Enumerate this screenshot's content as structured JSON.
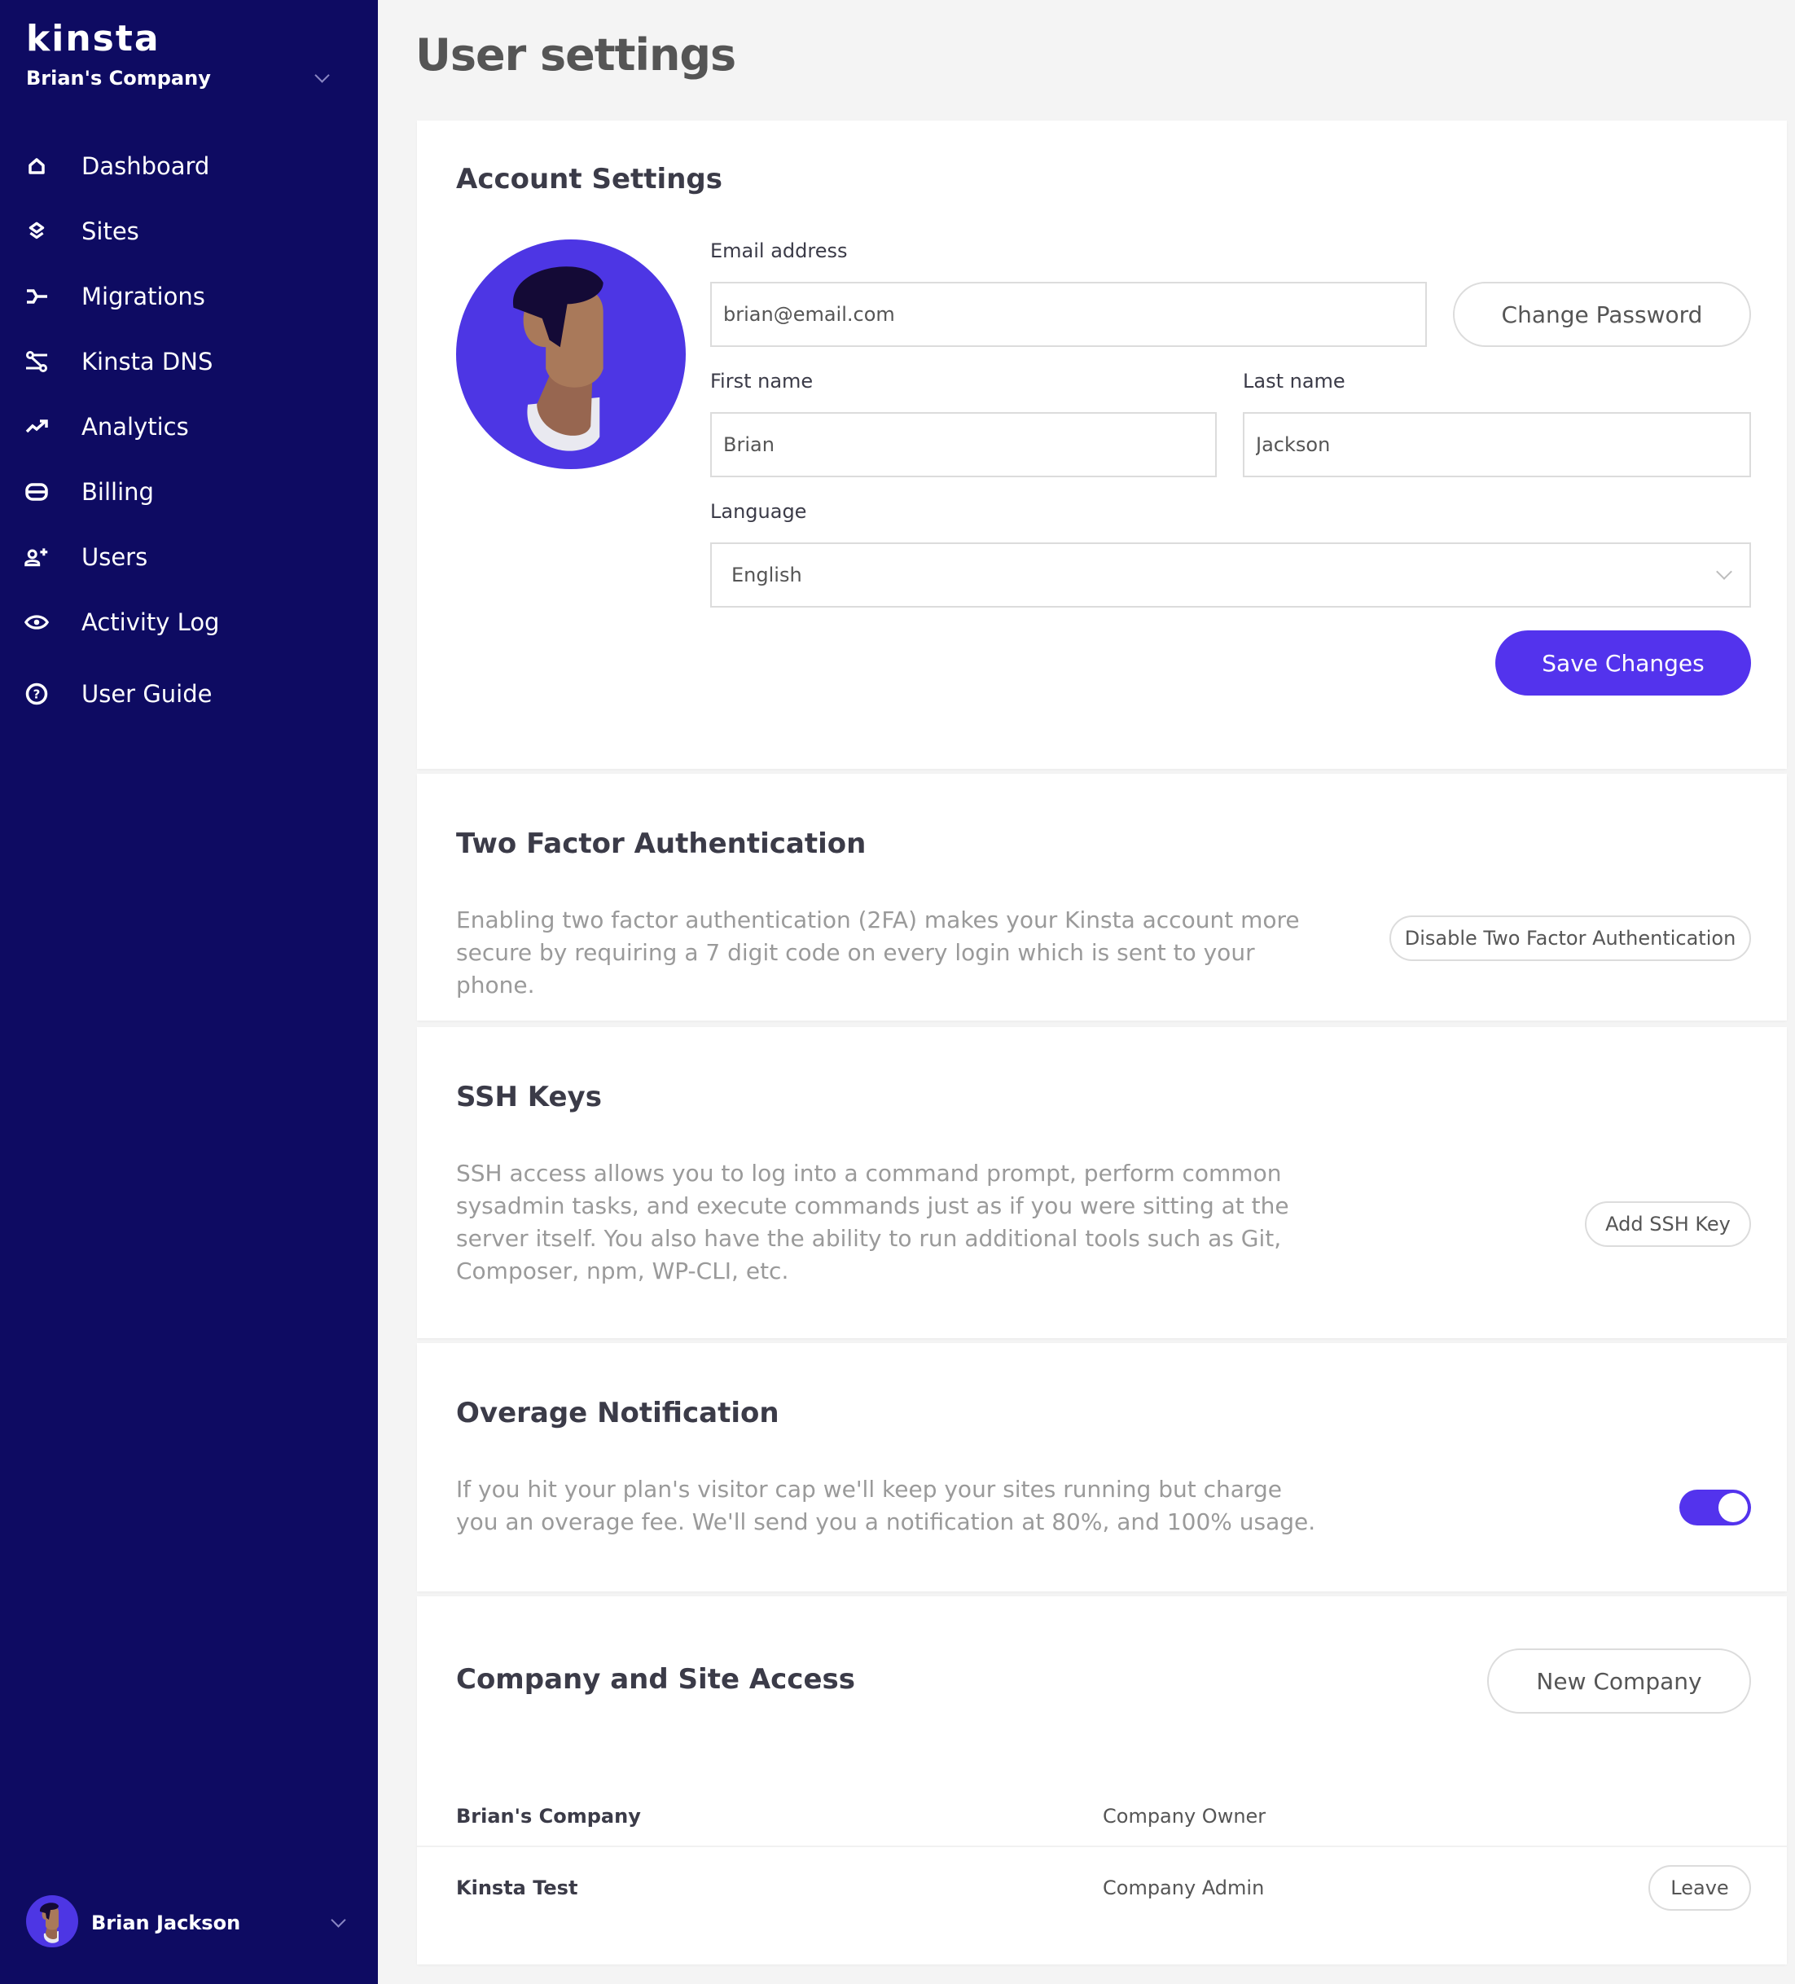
{
  "app": {
    "brand": "kinsta",
    "page_title": "User settings"
  },
  "sidebar": {
    "company_name": "Brian's Company",
    "items": [
      {
        "label": "Dashboard",
        "icon": "home-icon"
      },
      {
        "label": "Sites",
        "icon": "layers-icon"
      },
      {
        "label": "Migrations",
        "icon": "migrations-icon"
      },
      {
        "label": "Kinsta DNS",
        "icon": "dns-icon"
      },
      {
        "label": "Analytics",
        "icon": "trend-up-icon"
      },
      {
        "label": "Billing",
        "icon": "billing-icon"
      },
      {
        "label": "Users",
        "icon": "add-user-icon"
      },
      {
        "label": "Activity Log",
        "icon": "eye-icon"
      },
      {
        "label": "User Guide",
        "icon": "help-circle-icon"
      }
    ],
    "user_name": "Brian Jackson"
  },
  "account": {
    "title": "Account Settings",
    "email_label": "Email address",
    "email_value": "brian@email.com",
    "change_password": "Change Password",
    "first_name_label": "First name",
    "first_name_value": "Brian",
    "last_name_label": "Last name",
    "last_name_value": "Jackson",
    "language_label": "Language",
    "language_value": "English",
    "save": "Save Changes"
  },
  "two_factor": {
    "title": "Two Factor Authentication",
    "description": "Enabling two factor authentication (2FA) makes your Kinsta account more secure by requiring a 7 digit code on every login which is sent to your phone.",
    "button": "Disable Two Factor Authentication"
  },
  "ssh": {
    "title": "SSH Keys",
    "description": "SSH access allows you to log into a command prompt, perform common sysadmin tasks, and execute commands just as if you were sitting at the server itself. You also have the ability to run additional tools such as Git, Composer, npm, WP-CLI, etc.",
    "button": "Add SSH Key"
  },
  "overage": {
    "title": "Overage Notification",
    "description": "If you hit your plan's visitor cap we'll keep your sites running but charge you an overage fee. We'll send you a notification at 80%, and 100% usage.",
    "enabled": true
  },
  "company_access": {
    "title": "Company and Site Access",
    "new_button": "New Company",
    "rows": [
      {
        "name": "Brian's Company",
        "role": "Company Owner",
        "action": ""
      },
      {
        "name": "Kinsta Test",
        "role": "Company Admin",
        "action": "Leave"
      }
    ]
  },
  "colors": {
    "sidebar_bg": "#0e0b62",
    "accent": "#5333ed",
    "page_bg": "#f4f4f4"
  }
}
